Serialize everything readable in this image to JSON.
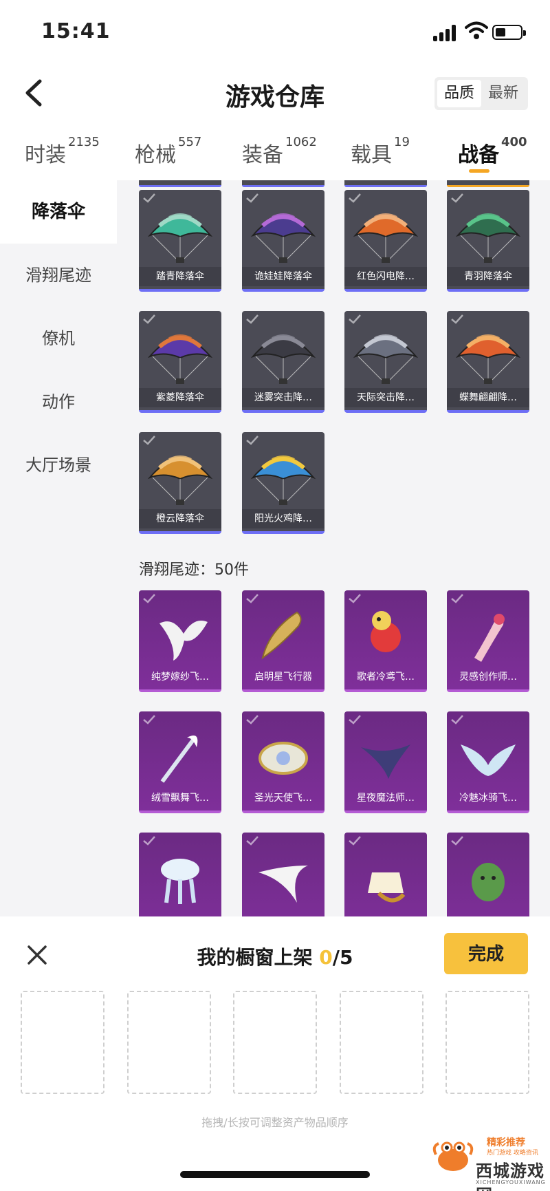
{
  "status_bar": {
    "time": "15:41"
  },
  "header": {
    "title": "游戏仓库",
    "sort_options": [
      "品质",
      "最新"
    ],
    "sort_active": "品质"
  },
  "tabs": [
    {
      "label": "时装",
      "count": "2135"
    },
    {
      "label": "枪械",
      "count": "557"
    },
    {
      "label": "装备",
      "count": "1062"
    },
    {
      "label": "载具",
      "count": "19"
    },
    {
      "label": "战备",
      "count": "400",
      "active": true
    }
  ],
  "sidebar": {
    "items": [
      {
        "label": "降落伞",
        "active": true
      },
      {
        "label": "滑翔尾迹"
      },
      {
        "label": "僚机"
      },
      {
        "label": "动作"
      },
      {
        "label": "大厅场景"
      }
    ]
  },
  "parachutes": [
    {
      "name": "踏青降落伞",
      "icon": "parachute-icon",
      "colors": [
        "#3fb89a",
        "#9fd9c6"
      ]
    },
    {
      "name": "诡娃娃降落伞",
      "icon": "parachute-icon",
      "colors": [
        "#4b3c8f",
        "#b46ad6"
      ]
    },
    {
      "name": "红色闪电降…",
      "icon": "parachute-icon",
      "colors": [
        "#e06a2a",
        "#f2b07a"
      ]
    },
    {
      "name": "青羽降落伞",
      "icon": "parachute-icon",
      "colors": [
        "#2f6e4f",
        "#59c48a"
      ]
    },
    {
      "name": "紫菱降落伞",
      "icon": "parachute-icon",
      "colors": [
        "#5b3aa8",
        "#e0773b"
      ]
    },
    {
      "name": "迷雾突击降…",
      "icon": "parachute-icon",
      "colors": [
        "#3b3b44",
        "#8a8a96"
      ]
    },
    {
      "name": "天际突击降…",
      "icon": "parachute-icon",
      "colors": [
        "#6b7080",
        "#c4c8d2"
      ]
    },
    {
      "name": "蝶舞翩翩降…",
      "icon": "parachute-icon",
      "colors": [
        "#e0602e",
        "#f4b066"
      ]
    },
    {
      "name": "橙云降落伞",
      "icon": "parachute-icon",
      "colors": [
        "#d7902f",
        "#f1c27a"
      ]
    },
    {
      "name": "阳光火鸡降…",
      "icon": "parachute-icon",
      "colors": [
        "#3a8fd6",
        "#f2c93e"
      ]
    }
  ],
  "trails_section": {
    "title": "滑翔尾迹：50件"
  },
  "trails": [
    {
      "name": "纯梦嫁纱飞…",
      "icon": "wing-trail-icon"
    },
    {
      "name": "启明星飞行器",
      "icon": "feather-trail-icon"
    },
    {
      "name": "歌者冷鸢飞…",
      "icon": "bird-trail-icon"
    },
    {
      "name": "灵感创作师…",
      "icon": "brush-trail-icon"
    },
    {
      "name": "绒雪飘舞飞…",
      "icon": "staff-trail-icon"
    },
    {
      "name": "圣光天使飞…",
      "icon": "halo-trail-icon"
    },
    {
      "name": "星夜魔法师…",
      "icon": "dark-wing-trail-icon"
    },
    {
      "name": "冷魅冰骑飞…",
      "icon": "ice-wing-trail-icon"
    },
    {
      "name": "",
      "icon": "jellyfish-trail-icon"
    },
    {
      "name": "",
      "icon": "white-feather-trail-icon"
    },
    {
      "name": "",
      "icon": "dress-trail-icon"
    },
    {
      "name": "",
      "icon": "cactus-trail-icon"
    }
  ],
  "showcase": {
    "title": "我的橱窗上架",
    "current": "0",
    "total": "/5",
    "done_label": "完成",
    "slot_count": 5,
    "hint": "拖拽/长按可调整资产物品顺序"
  },
  "watermark": {
    "tag": "精彩推荐",
    "sub": "热门游戏 攻略资讯",
    "name": "西城游戏网",
    "pinyin": "XICHENGYOUXIWANG"
  },
  "colors": {
    "accent": "#f5a623",
    "done_button": "#f7c13d",
    "card_gray": "#4b4b55",
    "card_purple": "#7f2f9a",
    "rare_line": "#6d6ef5"
  }
}
